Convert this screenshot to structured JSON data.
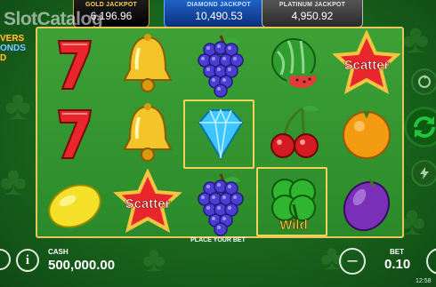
{
  "jackpots": {
    "gold": {
      "label": "GOLD JACKPOT",
      "value": "6,196.96"
    },
    "diamond": {
      "label": "DIAMOND JACKPOT",
      "value": "10,490.53"
    },
    "platinum": {
      "label": "PLATINUM JACKPOT",
      "value": "4,950.92"
    }
  },
  "watermark": "SlotCatalog",
  "logo": {
    "line1": "VERS",
    "line2": "ONDS",
    "line3": "D"
  },
  "reels": {
    "rows": [
      [
        "seven",
        "bell",
        "grapes",
        "watermelon",
        "scatter"
      ],
      [
        "seven",
        "bell",
        "diamond",
        "cherry",
        "orange"
      ],
      [
        "lemon",
        "scatter",
        "grapes",
        "wild",
        "plum"
      ]
    ],
    "scatter_text": "Scatter",
    "wild_text": "Wild"
  },
  "place_bet_text": "PLACE YOUR BET",
  "cash": {
    "label": "CASH",
    "value": "500,000.00"
  },
  "bet": {
    "label": "BET",
    "value": "0.10"
  },
  "clock": "12:58",
  "colors": {
    "frame_gold": "#e8c659",
    "reel_green": "#3ea136",
    "spin_green": "#22c23a"
  }
}
